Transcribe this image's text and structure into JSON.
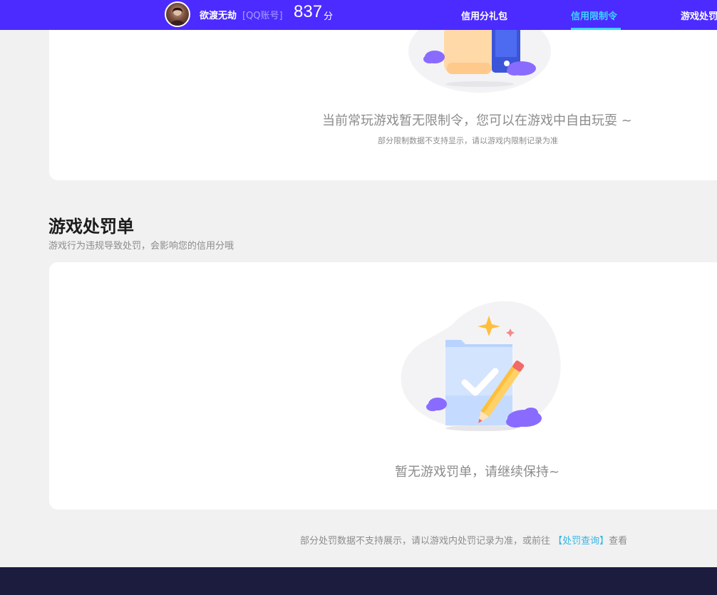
{
  "header": {
    "nickname": "欲渡无劫",
    "account_type": "[QQ账号]",
    "score": "837",
    "score_unit": "分",
    "nav": [
      {
        "label": "信用分礼包",
        "active": false
      },
      {
        "label": "信用限制令",
        "active": true
      },
      {
        "label": "游戏处罚单",
        "active": false
      }
    ],
    "accent_color": "#4b2bff",
    "active_color": "#3fd3ff"
  },
  "restriction": {
    "empty_message": "当前常玩游戏暂无限制令，您可以在游戏中自由玩耍 ~",
    "note": "部分限制数据不支持显示，请以游戏内限制记录为准",
    "illustration_icon": "phone-thumbs-up-illustration"
  },
  "penalty": {
    "title": "游戏处罚单",
    "subtitle": "游戏行为违规导致处罚，会影响您的信用分哦",
    "empty_message": "暂无游戏罚单，请继续保持~",
    "illustration_icon": "folder-check-pencil-illustration"
  },
  "footnote": {
    "text_before": "部分处罚数据不支持展示，请以游戏内处罚记录为准，或前往",
    "link_label": "【处罚查询】",
    "text_after": "查看"
  }
}
